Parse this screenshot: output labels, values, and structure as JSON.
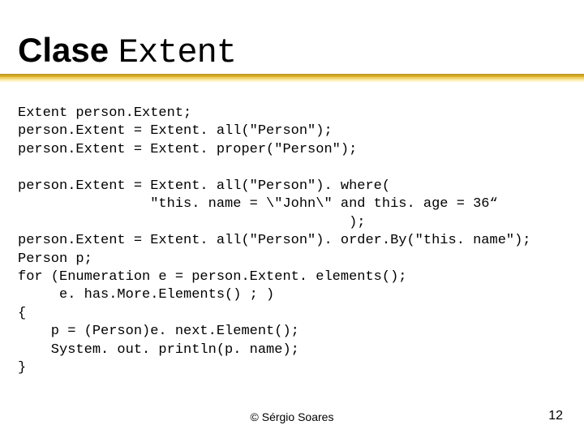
{
  "title": {
    "part1": "Clase ",
    "part2": "Extent"
  },
  "code": {
    "lines": [
      "Extent person.Extent;",
      "person.Extent = Extent. all(\"Person\");",
      "person.Extent = Extent. proper(\"Person\");",
      "",
      "person.Extent = Extent. all(\"Person\"). where(",
      "                \"this. name = \\\"John\\\" and this. age = 36“",
      "                                        );",
      "person.Extent = Extent. all(\"Person\"). order.By(\"this. name\");",
      "Person p;",
      "for (Enumeration e = person.Extent. elements();",
      "     e. has.More.Elements() ; )",
      "{",
      "    p = (Person)e. next.Element();",
      "    System. out. println(p. name);",
      "}"
    ]
  },
  "footer": {
    "copyright": "© Sérgio Soares",
    "page": "12"
  }
}
